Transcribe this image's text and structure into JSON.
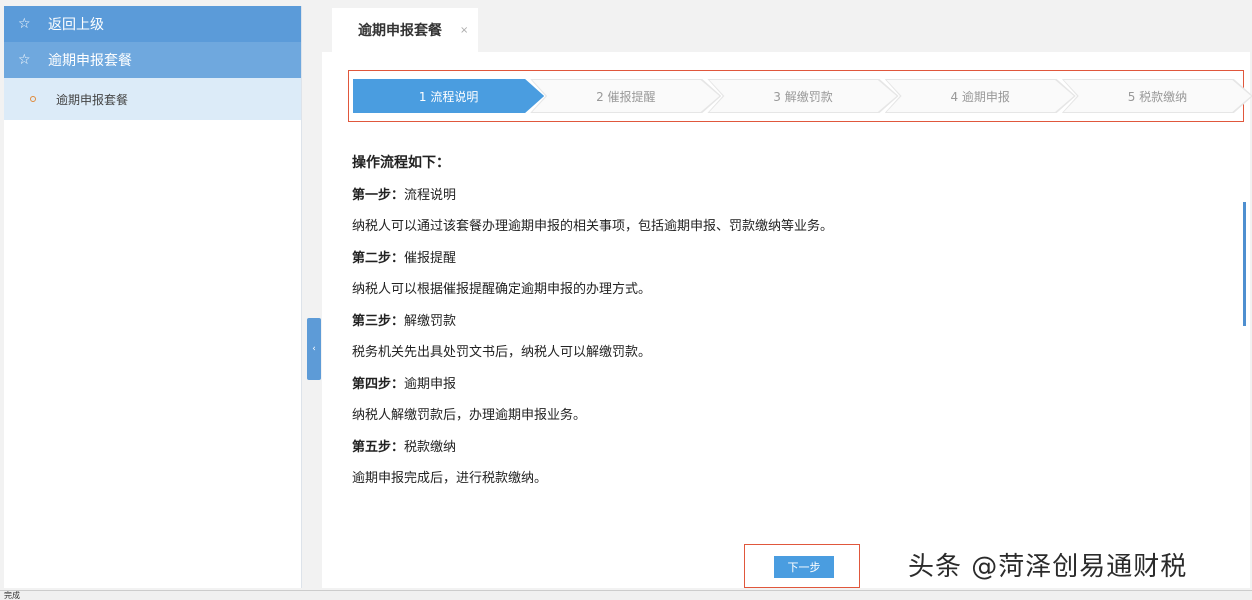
{
  "sidebar": {
    "back_label": "返回上级",
    "group_label": "逾期申报套餐",
    "sub_item_label": "逾期申报套餐"
  },
  "tab": {
    "label": "逾期申报套餐",
    "close": "×"
  },
  "steps": [
    {
      "label": "1  流程说明",
      "active": true
    },
    {
      "label": "2  催报提醒",
      "active": false
    },
    {
      "label": "3  解缴罚款",
      "active": false
    },
    {
      "label": "4  逾期申报",
      "active": false
    },
    {
      "label": "5  税款缴纳",
      "active": false
    }
  ],
  "content": {
    "heading": "操作流程如下：",
    "step1_title": "第一步：",
    "step1_name": "流程说明",
    "step1_desc": "纳税人可以通过该套餐办理逾期申报的相关事项，包括逾期申报、罚款缴纳等业务。",
    "step2_title": "第二步：",
    "step2_name": "催报提醒",
    "step2_desc": "纳税人可以根据催报提醒确定逾期申报的办理方式。",
    "step3_title": "第三步：",
    "step3_name": "解缴罚款",
    "step3_desc": "税务机关先出具处罚文书后，纳税人可以解缴罚款。",
    "step4_title": "第四步：",
    "step4_name": "逾期申报",
    "step4_desc": "纳税人解缴罚款后，办理逾期申报业务。",
    "step5_title": "第五步：",
    "step5_name": "税款缴纳",
    "step5_desc": "逾期申报完成后，进行税款缴纳。"
  },
  "next_button": "下一步",
  "watermark": "头条 @菏泽创易通财税",
  "status": "完成",
  "collapse_icon": "‹",
  "colors": {
    "primary": "#4a9de0",
    "sidebar_header": "#5b9bd9",
    "highlight_border": "#e0573c"
  }
}
